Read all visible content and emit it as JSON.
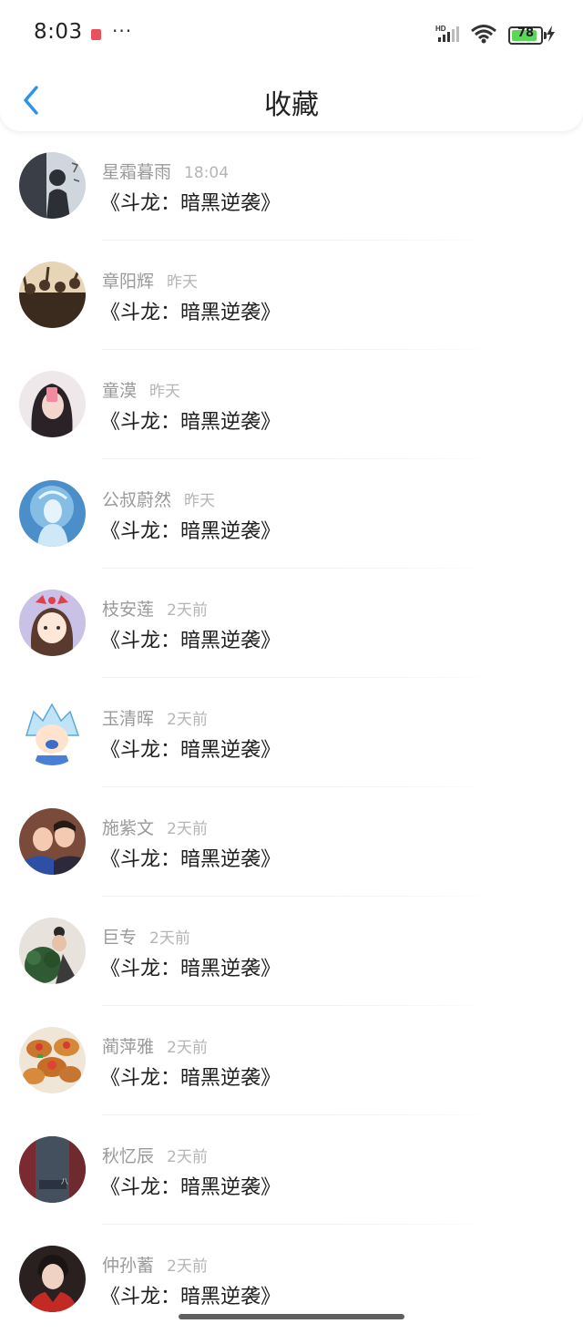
{
  "status_bar": {
    "time": "8:03",
    "more": "···",
    "battery_level": "78",
    "network": "HD"
  },
  "header": {
    "title": "收藏",
    "back_icon": "chevron-left-icon"
  },
  "colors": {
    "accent": "#2a93ea",
    "name": "#9a9a9a",
    "time": "#b5b5b5",
    "title": "#1e1e1e"
  },
  "favorites": [
    {
      "name": "星霜暮雨",
      "time": "18:04",
      "title": "《斗龙：暗黑逆袭》"
    },
    {
      "name": "章阳辉",
      "time": "昨天",
      "title": "《斗龙：暗黑逆袭》"
    },
    {
      "name": "童漠",
      "time": "昨天",
      "title": "《斗龙：暗黑逆袭》"
    },
    {
      "name": "公叔蔚然",
      "time": "昨天",
      "title": "《斗龙：暗黑逆袭》"
    },
    {
      "name": "枝安莲",
      "time": "2天前",
      "title": "《斗龙：暗黑逆袭》"
    },
    {
      "name": "玉清晖",
      "time": "2天前",
      "title": "《斗龙：暗黑逆袭》"
    },
    {
      "name": "施紫文",
      "time": "2天前",
      "title": "《斗龙：暗黑逆袭》"
    },
    {
      "name": "巨专",
      "time": "2天前",
      "title": "《斗龙：暗黑逆袭》"
    },
    {
      "name": "蔺萍雅",
      "time": "2天前",
      "title": "《斗龙：暗黑逆袭》"
    },
    {
      "name": "秋忆辰",
      "time": "2天前",
      "title": "《斗龙：暗黑逆袭》"
    },
    {
      "name": "仲孙蓄",
      "time": "2天前",
      "title": "《斗龙：暗黑逆袭》"
    }
  ]
}
